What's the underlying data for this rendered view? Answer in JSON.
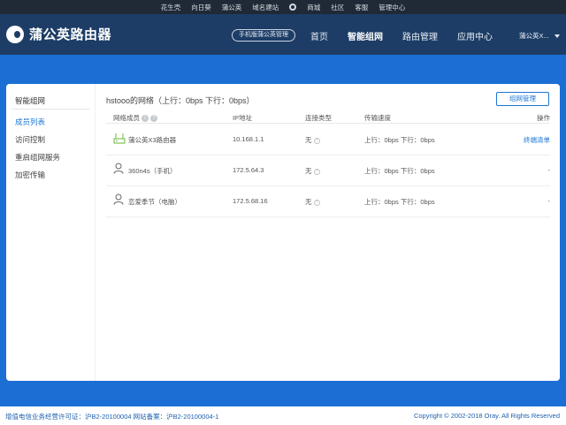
{
  "topbar": {
    "links": [
      "花生壳",
      "向日葵",
      "蒲公英",
      "域名建站",
      "商城",
      "社区",
      "客服",
      "管理中心"
    ]
  },
  "header": {
    "logo_text": "蒲公英路由器",
    "mobile_button": "手机版蒲公英管理",
    "nav": [
      "首页",
      "智能组网",
      "路由管理",
      "应用中心"
    ],
    "active_nav": "智能组网",
    "user": "蒲公英X..."
  },
  "sidebar": {
    "title": "智能组网",
    "items": [
      "成员列表",
      "访问控制",
      "重启组网服务",
      "加密传输"
    ],
    "active": "成员列表"
  },
  "main": {
    "title": "hstooo的网络（上行：0bps 下行：0bps）",
    "manage_button": "组网管理",
    "columns": [
      "网络成员",
      "IP地址",
      "连接类型",
      "传输速度",
      "操作"
    ],
    "rows": [
      {
        "name": "蒲公英X3路由器",
        "ip": "10.168.1.1",
        "conn": "无",
        "speed": "上行：0bps    下行：0bps",
        "action": "终端清单",
        "icon": "router-icon"
      },
      {
        "name": "360n4s（手机）",
        "ip": "172.5.64.3",
        "conn": "无",
        "speed": "上行：0bps    下行：0bps",
        "action": "-",
        "icon": "person-icon"
      },
      {
        "name": "恋爱季节（电脑）",
        "ip": "172.5.68.16",
        "conn": "无",
        "speed": "上行：0bps    下行：0bps",
        "action": "-",
        "icon": "person-icon"
      }
    ]
  },
  "footer": {
    "left": "增值电信业务经营许可证：沪B2-20100004   网站备案：沪B2-20100004-1",
    "right": "Copyright © 2002-2018 Oray. All Rights Reserved"
  },
  "colors": {
    "background": "#1b6fd4",
    "header": "#1d3d66",
    "topbar": "#1f2a36",
    "accent": "#1d76d3"
  }
}
